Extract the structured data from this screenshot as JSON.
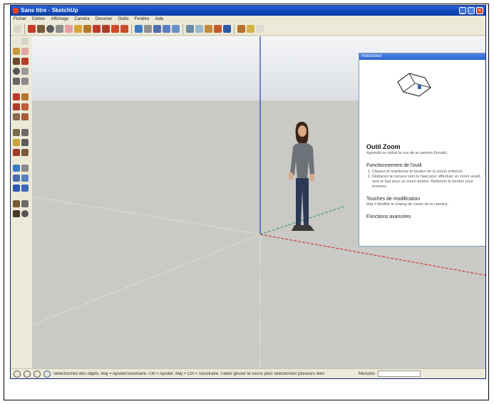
{
  "window": {
    "title": "Sans titre - SketchUp"
  },
  "menubar": {
    "items": [
      "Fichier",
      "Edition",
      "Affichage",
      "Caméra",
      "Dessiner",
      "Outils",
      "Fenêtre",
      "Aide"
    ]
  },
  "toolbar": {
    "icons": [
      "select-icon",
      "pencil-icon",
      "rectangle-icon",
      "circle-icon",
      "arc-icon",
      "eraser-icon",
      "paint-bucket-icon",
      "push-pull-icon",
      "move-icon",
      "rotate-icon",
      "scale-icon",
      "offset-icon",
      "orbit-icon",
      "pan-icon",
      "zoom-icon",
      "zoom-window-icon",
      "zoom-extents-icon",
      "iso-view-icon",
      "top-view-icon",
      "front-view-icon",
      "right-view-icon",
      "warehouse-icon",
      "share-icon",
      "components-icon"
    ]
  },
  "sidebar": {
    "icons": [
      "select-icon",
      "make-component-icon",
      "paint-bucket-icon",
      "eraser-icon",
      "rectangle-icon",
      "line-icon",
      "circle-icon",
      "arc-icon",
      "polygon-icon",
      "freehand-icon",
      "move-icon",
      "push-pull-icon",
      "rotate-icon",
      "follow-me-icon",
      "scale-icon",
      "offset-icon",
      "tape-measure-icon",
      "dimension-icon",
      "protractor-icon",
      "text-icon",
      "axes-icon",
      "3d-text-icon",
      "orbit-icon",
      "pan-icon",
      "zoom-icon",
      "zoom-window-icon",
      "zoom-extents-icon",
      "previous-icon",
      "walk-icon",
      "look-around-icon",
      "position-camera-icon",
      "section-plane-icon"
    ]
  },
  "instructor": {
    "header": "Instructeur",
    "title": "Outil Zoom",
    "description": "Agrandit ou réduit la vue de la caméra (focale).",
    "section_operation": "Fonctionnement de l'outil",
    "operation_steps": [
      "Cliquez et maintenez le bouton de la souris enfoncé.",
      "Déplacez le curseur vers le haut pour effectuer un zoom avant, vers le bas pour un zoom arrière. Relâchez le bouton pour terminer."
    ],
    "section_modifier": "Touches de modification",
    "modifier_text": "Maj = Modifie le champ de vision de la caméra.",
    "section_advanced": "Fonctions avancées"
  },
  "statusbar": {
    "hint": "Sélectionnez des objets. Maj = Ajouter/soustraire. Ctrl = Ajouter. Maj + Ctrl = Soustraire. Faites glisser la souris pour sélectionner plusieurs éléments.",
    "measure_label": "Mesures",
    "measure_value": ""
  },
  "colors": {
    "axis_blue": "#2b36b8",
    "axis_red": "#cc2020",
    "axis_green": "#2e9a3a",
    "sky": "#e9ecef",
    "ground": "#c9c9c6"
  }
}
